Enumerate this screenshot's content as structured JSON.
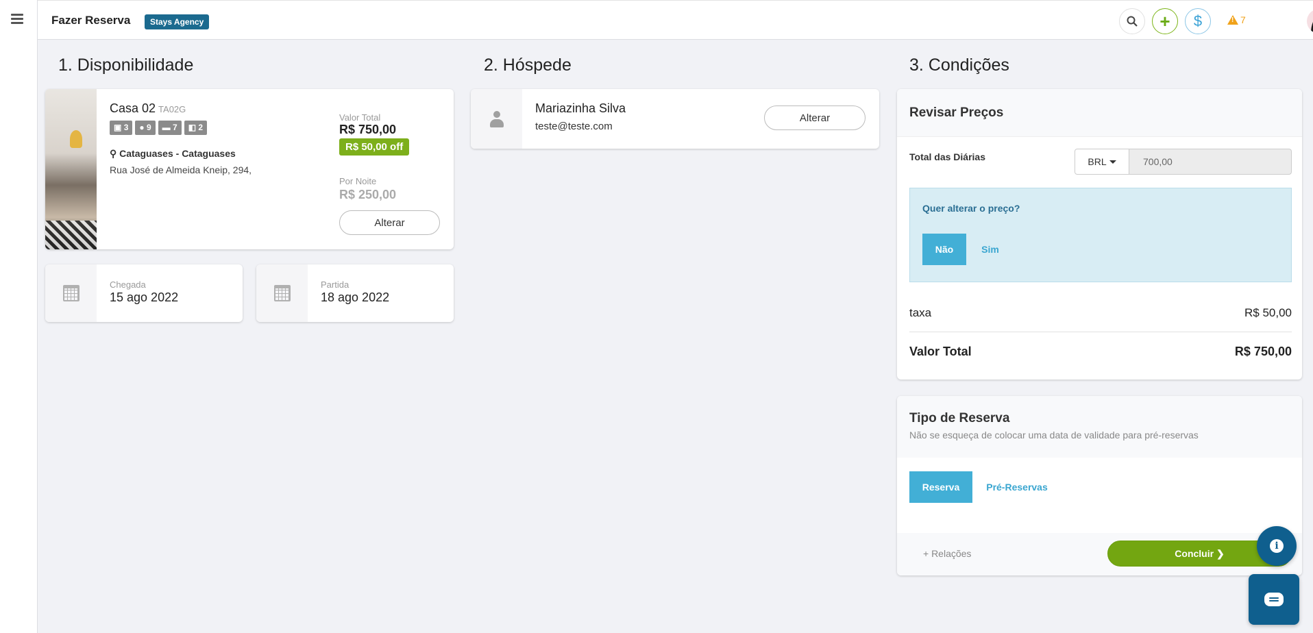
{
  "header": {
    "title": "Fazer Reserva",
    "agency_badge": "Stays Agency",
    "alert_count": "7",
    "plus_symbol": "+",
    "dollar_symbol": "$"
  },
  "sections": {
    "availability": "1. Disponibilidade",
    "guest": "2. Hóspede",
    "conditions": "3. Condições"
  },
  "property": {
    "name": "Casa 02",
    "code": "TA02G",
    "badges": [
      {
        "icon": "cube-icon",
        "value": "3"
      },
      {
        "icon": "person-icon",
        "value": "9"
      },
      {
        "icon": "bed-icon",
        "value": "7"
      },
      {
        "icon": "bath-icon",
        "value": "2"
      }
    ],
    "location": "Cataguases - Cataguases",
    "address": "Rua José de Almeida Kneip, 294,",
    "total_label": "Valor Total",
    "total_value": "R$ 750,00",
    "discount": "R$ 50,00 off",
    "per_night_label": "Por Noite",
    "per_night_value": "R$ 250,00",
    "change_button": "Alterar"
  },
  "dates": {
    "checkin_label": "Chegada",
    "checkin_value": "15 ago 2022",
    "checkout_label": "Partida",
    "checkout_value": "18 ago 2022"
  },
  "guest": {
    "name": "Mariazinha Silva",
    "email": "teste@teste.com",
    "change_button": "Alterar"
  },
  "review": {
    "title": "Revisar Preços",
    "daily_total_label": "Total das Diárias",
    "currency": "BRL",
    "daily_total_value": "700,00",
    "change_question": "Quer alterar o preço?",
    "option_no": "Não",
    "option_yes": "Sim",
    "fee_label": "taxa",
    "fee_value": "R$ 50,00",
    "total_label": "Valor Total",
    "total_value": "R$ 750,00"
  },
  "reservation_type": {
    "title": "Tipo de Reserva",
    "subtitle": "Não se esqueça de colocar uma data de validade para pré-reservas",
    "option_reserve": "Reserva",
    "option_pre": "Pré-Reservas",
    "relations": "+ Relações",
    "conclude": "Concluir ❯"
  },
  "colors": {
    "accent_blue": "#42afd6",
    "brand_dark_blue": "#0f5f8e",
    "success_green": "#73a611",
    "warning": "#f0a21a"
  }
}
